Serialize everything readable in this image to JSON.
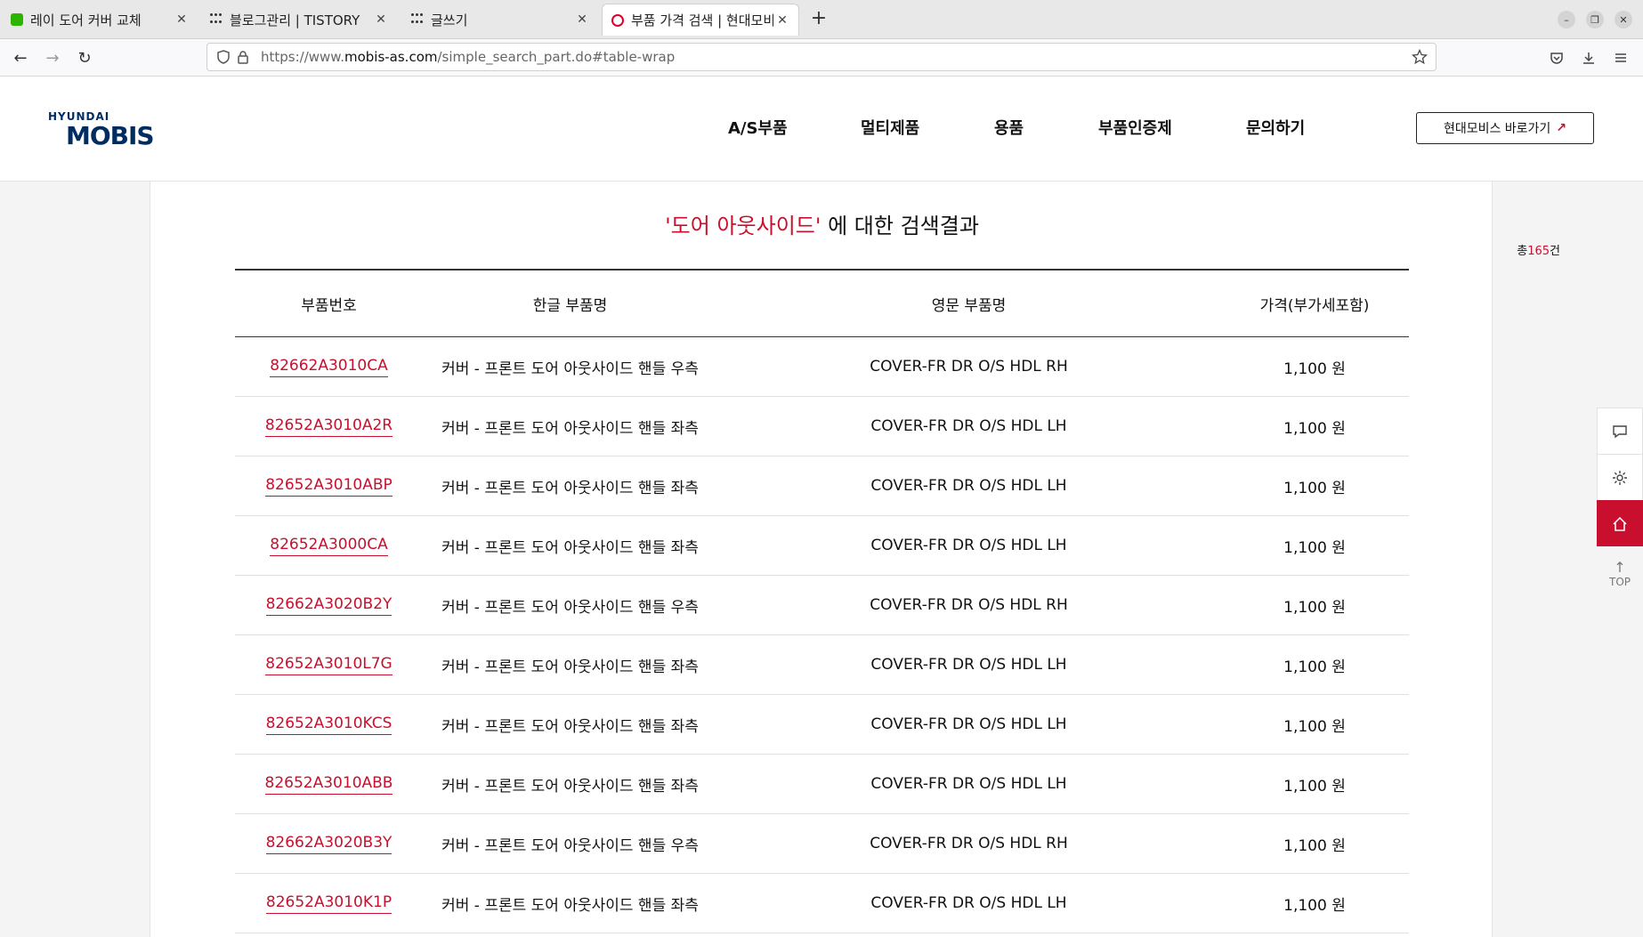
{
  "browser": {
    "tabs": [
      {
        "title": "레이 도어 커버 교체",
        "favicon": "green-square-icon"
      },
      {
        "title": "블로그관리 | TISTORY",
        "favicon": "tistory-dots-icon"
      },
      {
        "title": "글쓰기",
        "favicon": "tistory-dots-icon"
      },
      {
        "title": "부품 가격 검색 | 현대모비스",
        "favicon": "mobis-ring-icon",
        "active": true
      }
    ],
    "url_prefix": "https://www.",
    "url_domain": "mobis-as.com",
    "url_path": "/simple_search_part.do#table-wrap"
  },
  "site": {
    "logo_top": "HYUNDAI",
    "logo_main": "MOBIS",
    "nav": [
      "A/S부품",
      "멀티제품",
      "용품",
      "부품인증제",
      "문의하기"
    ],
    "shortcut_label": "현대모비스 바로가기",
    "shortcut_arrow": "↗"
  },
  "search": {
    "query_display": "'도어 아웃사이드'",
    "title_suffix": " 에 대한 검색결과",
    "total_prefix": "총",
    "total_count": "165",
    "total_suffix": "건"
  },
  "table": {
    "headers": [
      "부품번호",
      "한글 부품명",
      "영문 부품명",
      "가격(부가세포함)"
    ],
    "rows": [
      {
        "part_no": "82662A3010CA",
        "kr_name": "커버 - 프론트 도어 아웃사이드 핸들 우측",
        "en_name": "COVER-FR DR O/S HDL RH",
        "price": "1,100 원"
      },
      {
        "part_no": "82652A3010A2R",
        "kr_name": "커버 - 프론트 도어 아웃사이드 핸들 좌측",
        "en_name": "COVER-FR DR O/S HDL LH",
        "price": "1,100 원"
      },
      {
        "part_no": "82652A3010ABP",
        "kr_name": "커버 - 프론트 도어 아웃사이드 핸들 좌측",
        "en_name": "COVER-FR DR O/S HDL LH",
        "price": "1,100 원"
      },
      {
        "part_no": "82652A3000CA",
        "kr_name": "커버 - 프론트 도어 아웃사이드 핸들 좌측",
        "en_name": "COVER-FR DR O/S HDL LH",
        "price": "1,100 원"
      },
      {
        "part_no": "82662A3020B2Y",
        "kr_name": "커버 - 프론트 도어 아웃사이드 핸들 우측",
        "en_name": "COVER-FR DR O/S HDL RH",
        "price": "1,100 원"
      },
      {
        "part_no": "82652A3010L7G",
        "kr_name": "커버 - 프론트 도어 아웃사이드 핸들 좌측",
        "en_name": "COVER-FR DR O/S HDL LH",
        "price": "1,100 원"
      },
      {
        "part_no": "82652A3010KCS",
        "kr_name": "커버 - 프론트 도어 아웃사이드 핸들 좌측",
        "en_name": "COVER-FR DR O/S HDL LH",
        "price": "1,100 원"
      },
      {
        "part_no": "82652A3010ABB",
        "kr_name": "커버 - 프론트 도어 아웃사이드 핸들 좌측",
        "en_name": "COVER-FR DR O/S HDL LH",
        "price": "1,100 원"
      },
      {
        "part_no": "82662A3020B3Y",
        "kr_name": "커버 - 프론트 도어 아웃사이드 핸들 우측",
        "en_name": "COVER-FR DR O/S HDL RH",
        "price": "1,100 원"
      },
      {
        "part_no": "82652A3010K1P",
        "kr_name": "커버 - 프론트 도어 아웃사이드 핸들 좌측",
        "en_name": "COVER-FR DR O/S HDL LH",
        "price": "1,100 원"
      }
    ]
  },
  "quick_menu": {
    "items": [
      "chat-icon",
      "settings-icon",
      "home-icon"
    ],
    "top_label": "TOP"
  },
  "colors": {
    "accent": "#c8102e",
    "brand_navy": "#002c5f"
  }
}
